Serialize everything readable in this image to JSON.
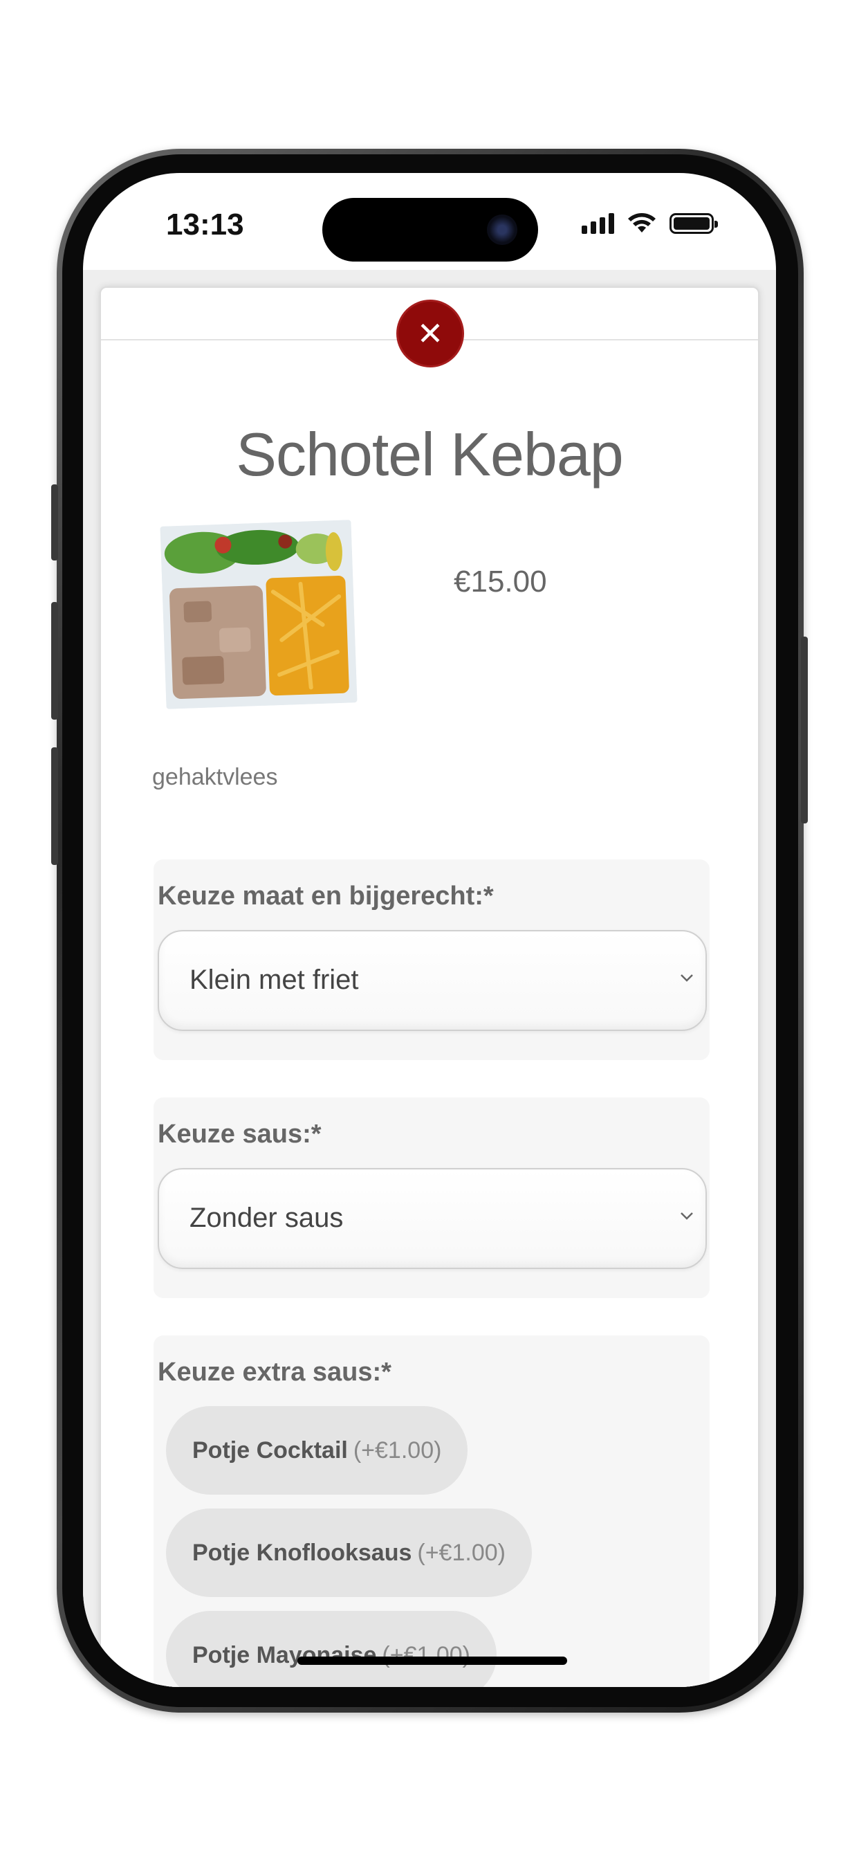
{
  "status_bar": {
    "time": "13:13",
    "icons": [
      "cellular-signal-icon",
      "wifi-icon",
      "battery-icon"
    ]
  },
  "modal": {
    "close_icon": "close-icon",
    "title": "Schotel Kebap",
    "price": "€15.00",
    "image_alt": "kebab-plate-image",
    "description": "gehaktvlees"
  },
  "options": {
    "size": {
      "label": "Keuze maat en bijgerecht:*",
      "selected": "Klein met friet"
    },
    "sauce": {
      "label": "Keuze saus:*",
      "selected": "Zonder saus"
    },
    "extra_sauce": {
      "label": "Keuze extra saus:*",
      "items": [
        {
          "name": "Potje Cocktail",
          "price": "(+€1.00)"
        },
        {
          "name": "Potje Knoflooksaus",
          "price": "(+€1.00)"
        },
        {
          "name": "Potje Mayonaise",
          "price": "(+€1.00)"
        }
      ]
    }
  },
  "colors": {
    "accent": "#8f0a0a",
    "text_muted": "#666666",
    "block_bg": "#f6f6f6",
    "pill_bg": "#e4e4e4"
  }
}
